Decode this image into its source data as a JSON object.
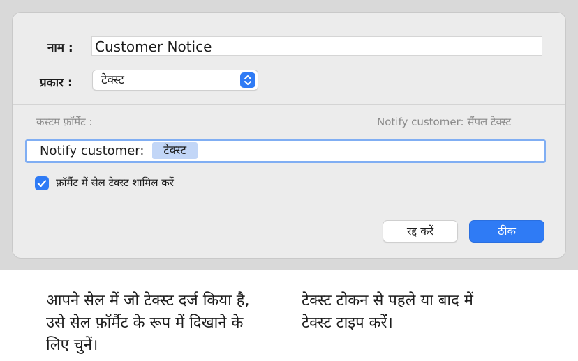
{
  "dialog": {
    "name_label": "नाम :",
    "name_value": "Customer Notice",
    "type_label": "प्रकार :",
    "type_value": "टेक्स्ट",
    "custom_format_label": "कस्टम फ़ॉर्मेट :",
    "sample_text": "Notify customer: सैंपल टेक्स्ट",
    "format_prefix": "Notify customer:",
    "token_label": "टेक्स्ट",
    "include_cell_text_label": "फ़ॉर्मैट में सेल टेक्स्ट शामिल करें",
    "include_cell_text_checked": true,
    "cancel_label": "रद्द करें",
    "ok_label": "ठीक"
  },
  "callouts": {
    "left": "आपने सेल में जो टेक्स्ट दर्ज किया है, उसे सेल फ़ॉर्मैट के रूप में दिखाने के लिए चुनें।",
    "right": "टेक्स्ट टोकन से पहले या बाद में टेक्स्ट टाइप करें।"
  },
  "colors": {
    "accent": "#2f7bf5",
    "token": "#c2d6f7",
    "focus_ring": "#80aef3"
  }
}
